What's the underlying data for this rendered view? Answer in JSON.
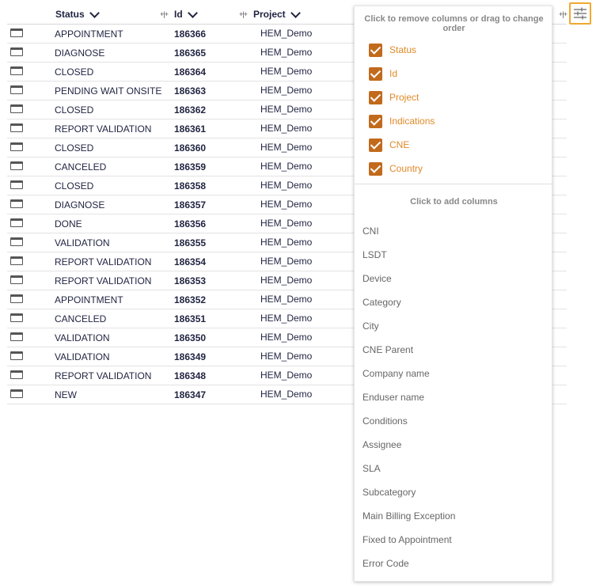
{
  "table": {
    "headers": {
      "status": "Status",
      "id": "Id",
      "project": "Project"
    },
    "rows": [
      {
        "status": "APPOINTMENT",
        "id": "186366",
        "project": "HEM_Demo"
      },
      {
        "status": "DIAGNOSE",
        "id": "186365",
        "project": "HEM_Demo"
      },
      {
        "status": "CLOSED",
        "id": "186364",
        "project": "HEM_Demo"
      },
      {
        "status": "PENDING WAIT ONSITE",
        "id": "186363",
        "project": "HEM_Demo"
      },
      {
        "status": "CLOSED",
        "id": "186362",
        "project": "HEM_Demo"
      },
      {
        "status": "REPORT VALIDATION",
        "id": "186361",
        "project": "HEM_Demo"
      },
      {
        "status": "CLOSED",
        "id": "186360",
        "project": "HEM_Demo"
      },
      {
        "status": "CANCELED",
        "id": "186359",
        "project": "HEM_Demo"
      },
      {
        "status": "CLOSED",
        "id": "186358",
        "project": "HEM_Demo"
      },
      {
        "status": "DIAGNOSE",
        "id": "186357",
        "project": "HEM_Demo"
      },
      {
        "status": "DONE",
        "id": "186356",
        "project": "HEM_Demo"
      },
      {
        "status": "VALIDATION",
        "id": "186355",
        "project": "HEM_Demo"
      },
      {
        "status": "REPORT VALIDATION",
        "id": "186354",
        "project": "HEM_Demo"
      },
      {
        "status": "REPORT VALIDATION",
        "id": "186353",
        "project": "HEM_Demo"
      },
      {
        "status": "APPOINTMENT",
        "id": "186352",
        "project": "HEM_Demo"
      },
      {
        "status": "CANCELED",
        "id": "186351",
        "project": "HEM_Demo"
      },
      {
        "status": "VALIDATION",
        "id": "186350",
        "project": "HEM_Demo"
      },
      {
        "status": "VALIDATION",
        "id": "186349",
        "project": "HEM_Demo"
      },
      {
        "status": "REPORT VALIDATION",
        "id": "186348",
        "project": "HEM_Demo"
      },
      {
        "status": "NEW",
        "id": "186347",
        "project": "HEM_Demo"
      }
    ]
  },
  "column_panel": {
    "remove_hint": "Click to remove columns or drag to change order",
    "selected_columns": [
      "Status",
      "Id",
      "Project",
      "Indications",
      "CNE",
      "Country"
    ],
    "add_hint": "Click to add columns",
    "available_columns": [
      "CNI",
      "LSDT",
      "Device",
      "Category",
      "City",
      "CNE Parent",
      "Company name",
      "Enduser name",
      "Conditions",
      "Assignee",
      "SLA",
      "Subcategory",
      "Main Billing Exception",
      "Fixed to Appointment",
      "Error Code"
    ]
  },
  "colors": {
    "accent": "#c26a1c",
    "selected_text": "#e08a28",
    "settings_border": "#f0a830"
  },
  "icons": {
    "row_icon": "window-icon",
    "settings": "column-settings-icon",
    "resize": "column-resize-icon",
    "sort": "chevron-down-icon"
  }
}
